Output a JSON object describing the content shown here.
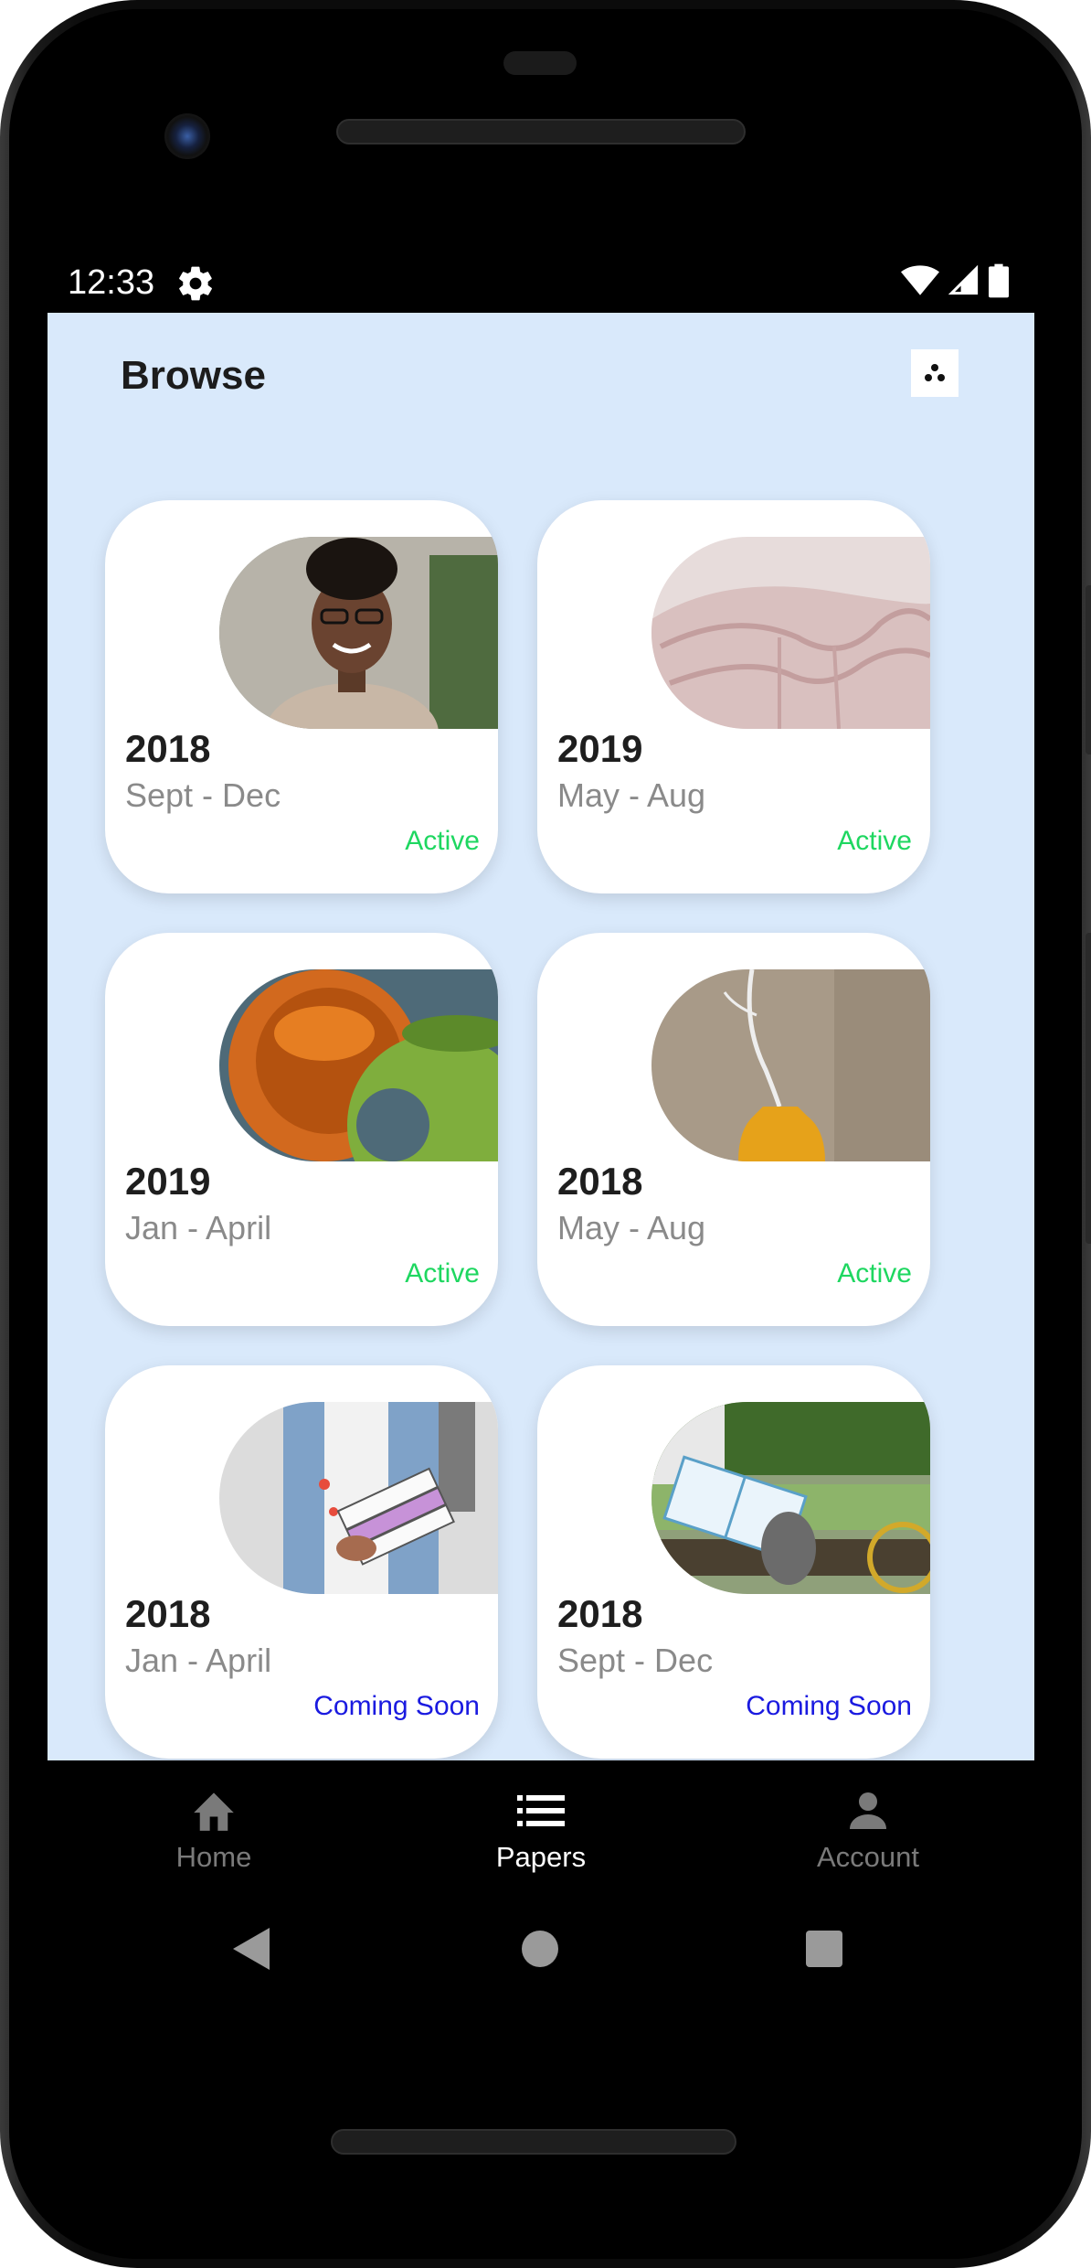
{
  "status_bar": {
    "time": "12:33",
    "icons": [
      "settings-icon",
      "wifi-icon",
      "signal-icon",
      "battery-icon"
    ]
  },
  "header": {
    "title": "Browse",
    "action_icon": "three-dots-icon"
  },
  "cards": [
    {
      "year": "2018",
      "term": "Sept - Dec",
      "status": "Active",
      "image": "woman-portrait"
    },
    {
      "year": "2019",
      "term": "May - Aug",
      "status": "Active",
      "image": "pink-curves"
    },
    {
      "year": "2019",
      "term": "Jan - April",
      "status": "Active",
      "image": "orange-green-spheres"
    },
    {
      "year": "2018",
      "term": "May - Aug",
      "status": "Active",
      "image": "yellow-vase"
    },
    {
      "year": "2018",
      "term": "Jan - April",
      "status": "Coming Soon",
      "image": "student-with-books"
    },
    {
      "year": "2018",
      "term": "Sept - Dec",
      "status": "Coming Soon",
      "image": "book-on-bench"
    }
  ],
  "bottom_nav": {
    "items": [
      {
        "label": "Home",
        "icon": "home-icon",
        "active": false
      },
      {
        "label": "Papers",
        "icon": "list-icon",
        "active": true
      },
      {
        "label": "Account",
        "icon": "person-icon",
        "active": false
      }
    ]
  },
  "system_nav": [
    "back-icon",
    "home-circle-icon",
    "recents-icon"
  ],
  "colors": {
    "screen_bg": "#d9e9fb",
    "active": "#1ed760",
    "coming_soon": "#1a1ae0"
  }
}
